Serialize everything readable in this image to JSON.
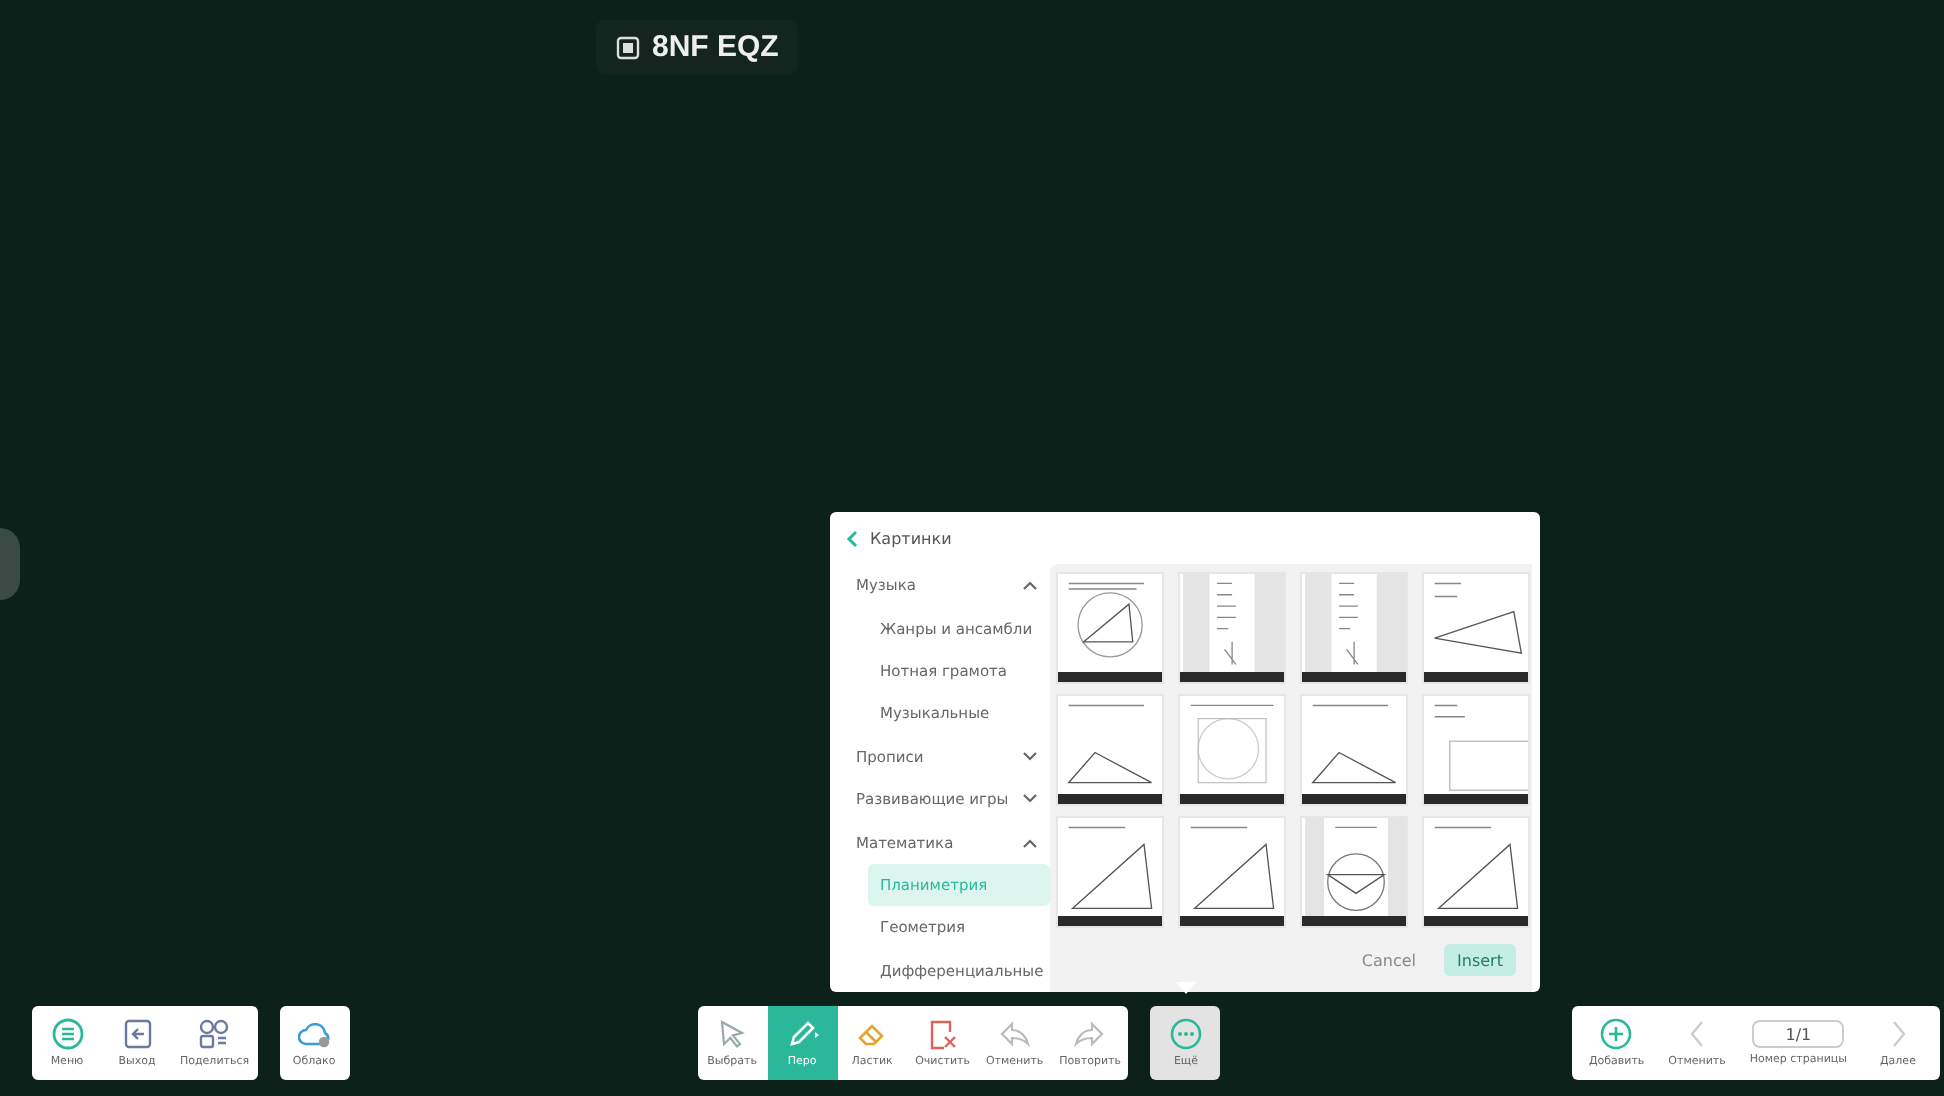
{
  "room_code": {
    "text": "8NF EQZ"
  },
  "picker": {
    "title": "Картинки",
    "nav": [
      {
        "label": "Музыка",
        "expanded": true,
        "children": [
          {
            "label": "Жанры и ансамбли",
            "selected": false
          },
          {
            "label": "Нотная грамота",
            "selected": false
          },
          {
            "label": "Музыкальные",
            "selected": false
          }
        ]
      },
      {
        "label": "Прописи",
        "expanded": false
      },
      {
        "label": "Развивающие игры",
        "expanded": false
      },
      {
        "label": "Математика",
        "expanded": true,
        "children": [
          {
            "label": "Планиметрия",
            "selected": true
          },
          {
            "label": "Геометрия",
            "selected": false
          },
          {
            "label": "Дифференциальные",
            "selected": false
          }
        ]
      }
    ],
    "thumbnails": [
      {
        "kind": "circle"
      },
      {
        "kind": "strip"
      },
      {
        "kind": "strip"
      },
      {
        "kind": "wedge"
      },
      {
        "kind": "triangle"
      },
      {
        "kind": "disc"
      },
      {
        "kind": "triangle"
      },
      {
        "kind": "rect"
      },
      {
        "kind": "slope"
      },
      {
        "kind": "slope"
      },
      {
        "kind": "dome"
      },
      {
        "kind": "slope"
      }
    ],
    "cancel": "Cancel",
    "insert": {
      "label": "Insert",
      "disabled": true
    }
  },
  "left_toolbar": [
    {
      "kind": "menu",
      "label": "Меню"
    },
    {
      "kind": "exit",
      "label": "Выход"
    },
    {
      "kind": "share",
      "label": "Поделиться"
    }
  ],
  "cloud_button": {
    "kind": "cloud",
    "label": "Облако"
  },
  "tools": [
    {
      "kind": "select",
      "label": "Выбрать",
      "selected": false
    },
    {
      "kind": "pen",
      "label": "Перо",
      "selected": true
    },
    {
      "kind": "eraser",
      "label": "Ластик",
      "selected": false
    },
    {
      "kind": "clear",
      "label": "Очистить",
      "selected": false
    },
    {
      "kind": "undo",
      "label": "Отменить",
      "selected": false
    },
    {
      "kind": "redo",
      "label": "Повторить",
      "selected": false
    }
  ],
  "more_button": {
    "kind": "more",
    "label": "Ещё"
  },
  "pager": {
    "add": "Добавить",
    "prev": "Отменить",
    "page": "1/1",
    "page_label": "Номер страницы",
    "next": "Далее"
  }
}
